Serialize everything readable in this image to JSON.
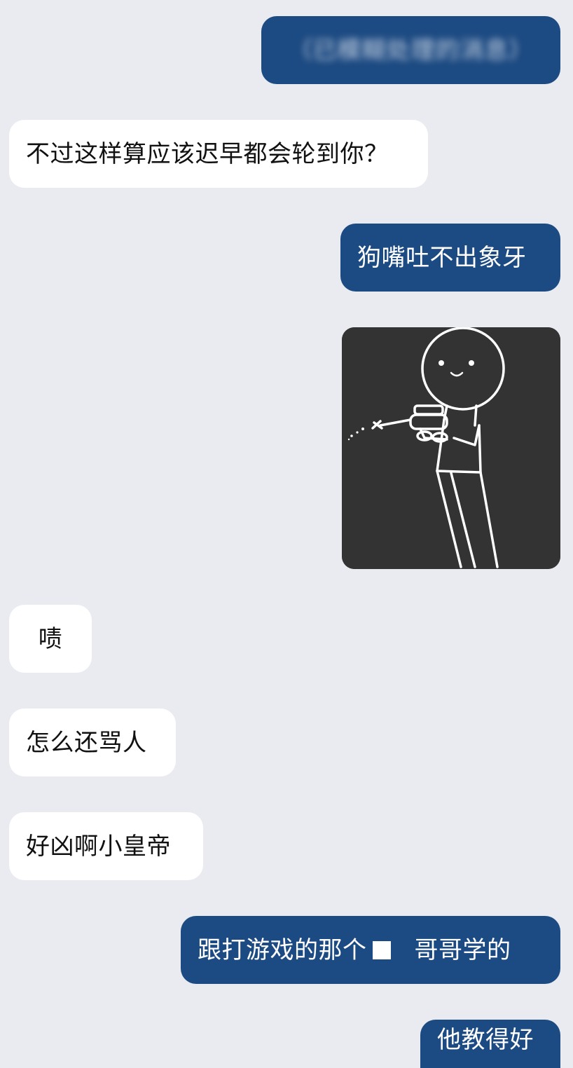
{
  "colors": {
    "background": "#e9ebf0",
    "outgoing_bubble": "#1c4a82",
    "incoming_bubble": "#ffffff",
    "sticker_background": "#333333"
  },
  "messages": [
    {
      "direction": "outgoing",
      "text": "（已模糊处理的消息）",
      "blurred": true
    },
    {
      "direction": "incoming",
      "text": "不过这样算应该迟早都会轮到你？"
    },
    {
      "direction": "outgoing",
      "text": "狗嘴吐不出象牙"
    },
    {
      "direction": "outgoing",
      "type": "sticker",
      "sticker": "stick-figure-water-gun"
    },
    {
      "direction": "incoming",
      "text": "啧"
    },
    {
      "direction": "incoming",
      "text": "怎么还骂人"
    },
    {
      "direction": "incoming",
      "text": "好凶啊小皇帝"
    },
    {
      "direction": "outgoing",
      "text_before": "跟打游戏的那个",
      "text_after": "哥哥学的",
      "redacted": true
    },
    {
      "direction": "outgoing",
      "text": "他教得好"
    }
  ]
}
